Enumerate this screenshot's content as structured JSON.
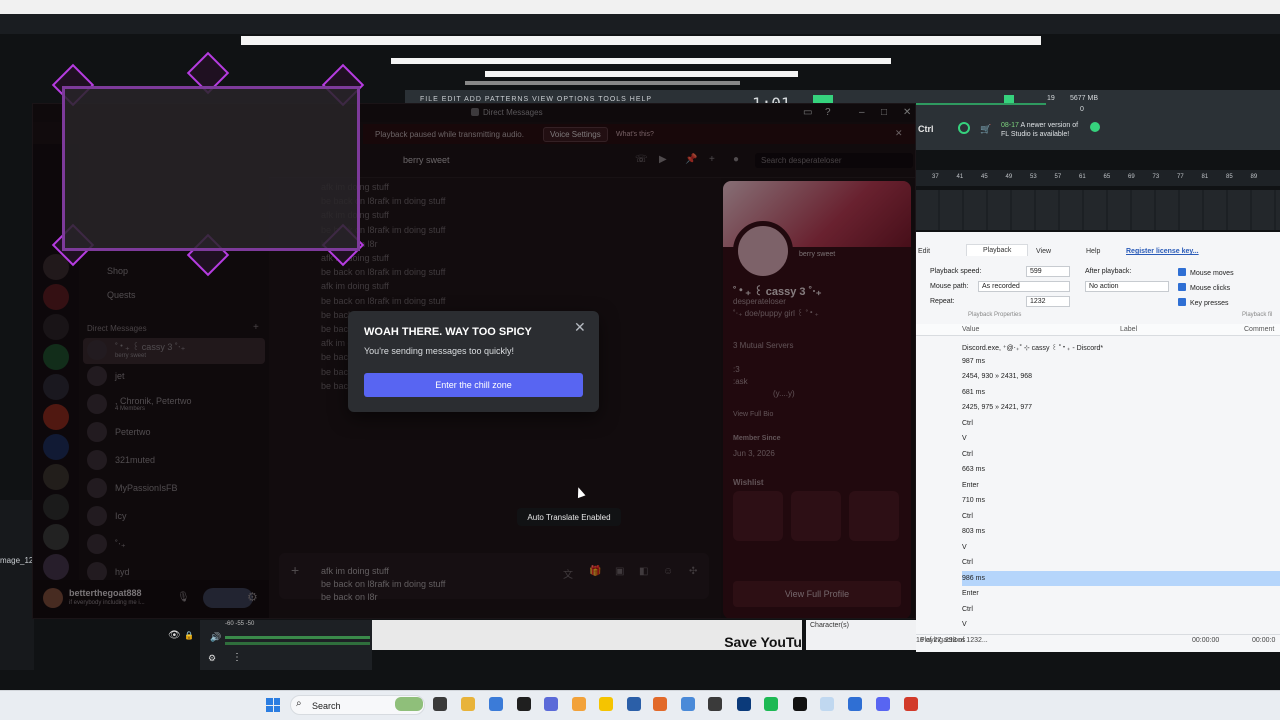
{
  "fl_studio": {
    "menu": "FILE  EDIT  ADD  PATTERNS  VIEW  OPTIONS  TOOLS  HELP",
    "time": "1:01",
    "cpu": "19",
    "ram": "5677 MB",
    "zero": "0",
    "ctrl_label": "Ctrl",
    "news_date": "08-17",
    "news_text_1": "A newer version of",
    "news_text_2": "FL Studio is available!",
    "ruler": [
      "37",
      "41",
      "45",
      "49",
      "53",
      "57",
      "61",
      "65",
      "69",
      "73",
      "77",
      "81",
      "85",
      "89"
    ]
  },
  "macro": {
    "tabs": [
      "Edit",
      "Playback",
      "View",
      "Help"
    ],
    "license_link": "Register license key...",
    "playback_speed_label": "Playback speed:",
    "playback_speed_value": "599",
    "mouse_path_label": "Mouse path:",
    "mouse_path_value": "As recorded",
    "repeat_label": "Repeat:",
    "repeat_value": "1232",
    "after_playback_label": "After playback:",
    "after_playback_value": "No action",
    "checks": [
      "Mouse moves",
      "Mouse clicks",
      "Key presses"
    ],
    "section_playback_props": "Playback Properties",
    "section_playback_filter": "Playback fil",
    "columns": [
      "Value",
      "Label",
      "Comment"
    ],
    "rows": [
      "Discord.exe, ⁺@‧₊˚ ⊹ cassy ꒰ ˚‧₊ - Discord*",
      "987 ms",
      "2454, 930 » 2431, 968",
      "681 ms",
      "2425, 975 » 2421, 977",
      "Ctrl",
      "V",
      "Ctrl",
      "663 ms",
      "Enter",
      "710 ms",
      "Ctrl",
      "803 ms",
      "V",
      "Ctrl",
      "986 ms",
      "Enter",
      "Ctrl",
      "V"
    ],
    "selected_row": 15,
    "char_label": "Character(s)",
    "status_left": "16 of 27 actions",
    "status_mid": "Playing 293 of 1232...",
    "status_time1": "00:00:00",
    "status_time2": "00:00:0"
  },
  "left": {
    "image_label": "mage_12"
  },
  "obs": {
    "meter_ticks": "-60          -55          -50"
  },
  "youtube": {
    "save_text": "Save YouTu"
  },
  "discord": {
    "window_title": "Direct Messages",
    "banner_text": "Playback paused while transmitting audio.",
    "banner_button": "Voice Settings",
    "banner_link": "What's this?",
    "shop_label": "Shop",
    "quests_label": "Quests",
    "dm_header": "Direct Messages",
    "dms": [
      {
        "name": "˚‧₊ ꒰ cassy 3 ˚‧₊",
        "sub": "berry sweet"
      },
      {
        "name": "jet",
        "sub": ""
      },
      {
        "name": ", Chronik, Petertwo",
        "sub": "4 Members"
      },
      {
        "name": "Petertwo",
        "sub": ""
      },
      {
        "name": "321muted",
        "sub": ""
      },
      {
        "name": "MyPassionIsFB",
        "sub": ""
      },
      {
        "name": "Icy",
        "sub": ""
      },
      {
        "name": "˚‧₊",
        "sub": ""
      },
      {
        "name": "hyd",
        "sub": ""
      }
    ],
    "user_name": "betterthegoat888",
    "user_status": "if everybody including me i...",
    "chat_header_name": "berry sweet",
    "search_placeholder": "Search desperateloser",
    "messages": [
      "afk im doing stuff",
      "be back on l8rafk im doing stuff",
      "afk im doing stuff",
      "be back on l8rafk im doing stuff",
      "be back on l8r",
      "afk im doing stuff",
      "be back on l8rafk im doing stuff",
      "afk im doing stuff",
      "be back on l8rafk im doing stuff",
      "be back on l8rafk im doing stuff",
      "be back on l8rafk im doing stuff",
      "afk im doing stuff",
      "be back on l8rafk im doing stuff",
      "be back on l8rafk im doing stuff",
      "be back on l8r"
    ],
    "input_lines": [
      "afk im doing stuff",
      "be back on l8rafk im doing stuff",
      "be back on l8r"
    ],
    "profile": {
      "tag": "berry sweet",
      "display_name": "˚‧₊ ꒰ cassy 3 ˚‧₊",
      "username": "desperateloser",
      "pronouns": "˚‧₊ doe/puppy girl ꒰ ˚‧₊",
      "mutual": "3 Mutual Servers",
      "bio1": ":3",
      "bio2": ":ask",
      "bio3": "(y....y)",
      "view_bio": "View Full Bio",
      "member_since_label": "Member Since",
      "member_since": "Jun 3, 2026",
      "wishlist_label": "Wishlist",
      "view_profile": "View Full Profile"
    },
    "modal": {
      "title": "WOAH THERE. WAY TOO SPICY",
      "subtitle": "You're sending messages too quickly!",
      "button": "Enter the chill zone"
    },
    "tooltip": "Auto Translate Enabled"
  },
  "taskbar": {
    "search_placeholder": "Search"
  },
  "colors": {
    "discord_blurple": "#5865f2",
    "profile_bg": "#3a1119",
    "overlay_purple": "#b53ce0",
    "macro_selected": "#b5d5fb"
  }
}
